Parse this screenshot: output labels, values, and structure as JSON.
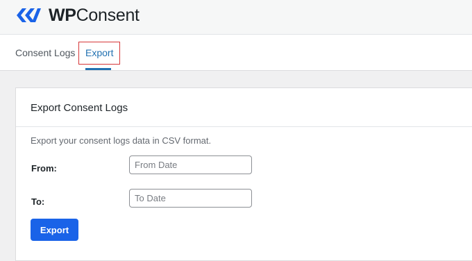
{
  "brand": {
    "logo_text_bold": "WP",
    "logo_text_light": "Consent",
    "logo_icon": "wpconsent-logo-icon",
    "accent_color": "#1a63e8"
  },
  "tabs": [
    {
      "label": "Consent Logs",
      "active": false
    },
    {
      "label": "Export",
      "active": true
    }
  ],
  "export_card": {
    "title": "Export Consent Logs",
    "description": "Export your consent logs data in CSV format.",
    "from_label": "From:",
    "from_placeholder": "From Date",
    "to_label": "To:",
    "to_placeholder": "To Date",
    "button_label": "Export"
  }
}
